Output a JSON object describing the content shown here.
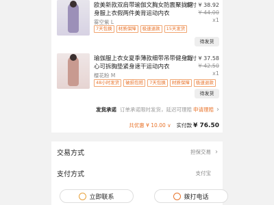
{
  "products": [
    {
      "name": "欧美新款双肩带瑜伽文胸女防震聚拢健身服上衣假两件美背运动内衣",
      "variant": "雾空紫 L",
      "price": "实付 ¥ 38.92",
      "original_price": "¥ 44.00",
      "quantity": "x1",
      "tags": [
        "7天包换",
        "材质保障",
        "极速退款",
        "15天发货"
      ],
      "ship_button": "待发货"
    },
    {
      "name": "瑜伽服上衣女夏季薄款细带吊带健身背心可拆胸垫紧身速干运动内衣",
      "variant": "樱花粉 M",
      "price": "实付 ¥ 37.58",
      "original_price": "¥ 42.50",
      "quantity": "x1",
      "tags": [
        "48小时发货",
        "破损包赔",
        "7天包换",
        "材质保障",
        "极速退款"
      ],
      "ship_button": "待发货"
    }
  ],
  "shipping_promise": {
    "label": "发货承诺",
    "desc": "订单承诺限时发货，延迟可理赔",
    "link": "申请理赔"
  },
  "summary": {
    "discount": "共优惠 ¥ 10.00 ∨",
    "pay_label": "实付款",
    "pay_amount": "¥ 76.50"
  },
  "rows": {
    "trade_title": "交易方式",
    "trade_value": "担保交易",
    "payment_title": "支付方式",
    "payment_value": "支付宝"
  },
  "actions": {
    "contact": "立即联系",
    "call": "拨打电话"
  },
  "colors": {
    "accent": "#e8732a"
  }
}
